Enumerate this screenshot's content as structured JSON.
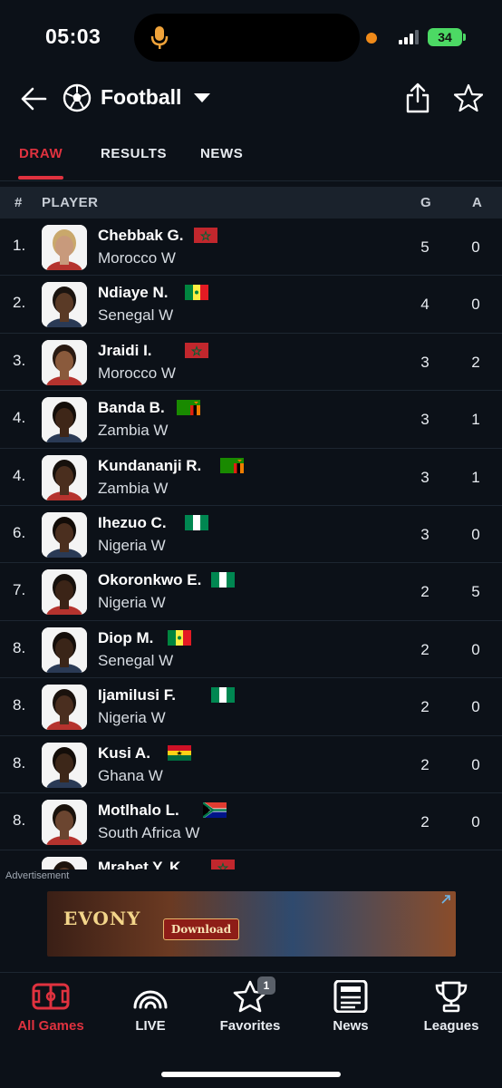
{
  "status_bar": {
    "time": "05:03",
    "battery": "34"
  },
  "header": {
    "title": "Football"
  },
  "tabs": [
    {
      "label": "DRAW",
      "active": true
    },
    {
      "label": "RESULTS",
      "active": false
    },
    {
      "label": "NEWS",
      "active": false
    }
  ],
  "table": {
    "columns": {
      "rank": "#",
      "player": "PLAYER",
      "goals": "G",
      "assists": "A"
    },
    "rows": [
      {
        "rank": "1.",
        "name": "Chebbak G.",
        "team": "Morocco W",
        "flag": "morocco-flag",
        "goals": "5",
        "assists": "0"
      },
      {
        "rank": "2.",
        "name": "Ndiaye N.",
        "team": "Senegal W",
        "flag": "senegal-flag",
        "goals": "4",
        "assists": "0"
      },
      {
        "rank": "3.",
        "name": "Jraidi I.",
        "team": "Morocco W",
        "flag": "morocco-flag",
        "goals": "3",
        "assists": "2"
      },
      {
        "rank": "4.",
        "name": "Banda B.",
        "team": "Zambia W",
        "flag": "zambia-flag",
        "goals": "3",
        "assists": "1"
      },
      {
        "rank": "4.",
        "name": "Kundananji R.",
        "team": "Zambia W",
        "flag": "zambia-flag",
        "goals": "3",
        "assists": "1"
      },
      {
        "rank": "6.",
        "name": "Ihezuo C.",
        "team": "Nigeria W",
        "flag": "nigeria-flag",
        "goals": "3",
        "assists": "0"
      },
      {
        "rank": "7.",
        "name": "Okoronkwo E.",
        "team": "Nigeria W",
        "flag": "nigeria-flag",
        "goals": "2",
        "assists": "5"
      },
      {
        "rank": "8.",
        "name": "Diop M.",
        "team": "Senegal W",
        "flag": "senegal-flag",
        "goals": "2",
        "assists": "0"
      },
      {
        "rank": "8.",
        "name": "Ijamilusi F.",
        "team": "Nigeria W",
        "flag": "nigeria-flag",
        "goals": "2",
        "assists": "0"
      },
      {
        "rank": "8.",
        "name": "Kusi A.",
        "team": "Ghana W",
        "flag": "ghana-flag",
        "goals": "2",
        "assists": "0"
      },
      {
        "rank": "8.",
        "name": "Motlhalo L.",
        "team": "South Africa W",
        "flag": "south-africa-flag",
        "goals": "2",
        "assists": "0"
      },
      {
        "rank": "",
        "name": "Mrabet Y. K.",
        "team": "",
        "flag": "morocco-flag",
        "goals": "",
        "assists": ""
      }
    ]
  },
  "ad": {
    "label": "Advertisement",
    "brand": "EVONY",
    "button": "Download"
  },
  "bottom_nav": [
    {
      "label": "All Games",
      "icon": "pitch-icon",
      "active": true
    },
    {
      "label": "LIVE",
      "icon": "live-signal-icon",
      "active": false
    },
    {
      "label": "Favorites",
      "icon": "star-icon",
      "active": false,
      "badge": "1"
    },
    {
      "label": "News",
      "icon": "newspaper-icon",
      "active": false
    },
    {
      "label": "Leagues",
      "icon": "trophy-icon",
      "active": false
    }
  ],
  "colors": {
    "accent": "#e0323f",
    "background": "#0c1118",
    "header_row": "#1a222c"
  }
}
